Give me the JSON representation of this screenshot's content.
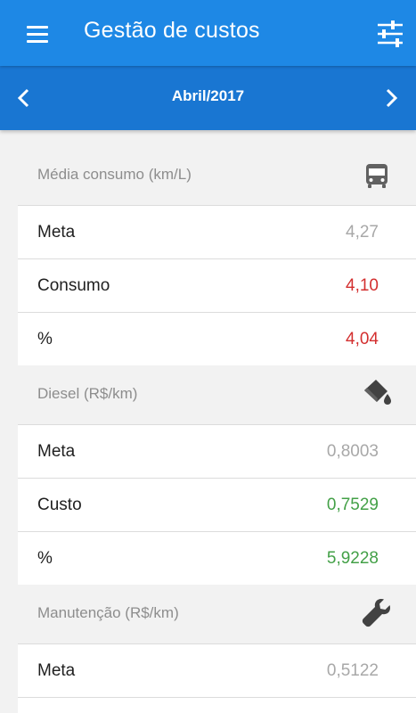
{
  "app": {
    "title": "Gestão de custos"
  },
  "period": {
    "label": "Abril/2017"
  },
  "sections": [
    {
      "title": "Média consumo (km/L)",
      "icon": "bus-icon",
      "rows": [
        {
          "label": "Meta",
          "value": "4,27"
        },
        {
          "label": "Consumo",
          "value": "4,10"
        },
        {
          "label": "%",
          "value": "4,04"
        }
      ]
    },
    {
      "title": "Diesel (R$/km)",
      "icon": "fuel-can-icon",
      "rows": [
        {
          "label": "Meta",
          "value": "0,8003"
        },
        {
          "label": "Custo",
          "value": "0,7529"
        },
        {
          "label": "%",
          "value": "5,9228"
        }
      ]
    },
    {
      "title": "Manutenção (R$/km)",
      "icon": "wrench-icon",
      "rows": [
        {
          "label": "Meta",
          "value": "0,5122"
        }
      ]
    }
  ],
  "colors": {
    "primary": "#1e88e5",
    "primary_dark": "#1976d2",
    "negative": "#d32f2f",
    "positive": "#43a047",
    "muted": "#a8a8a8"
  }
}
